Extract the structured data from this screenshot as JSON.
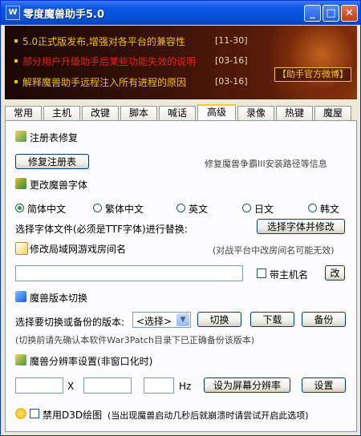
{
  "window": {
    "title": "零度魔兽助手5.0"
  },
  "banner": {
    "news": [
      {
        "text": "5.0正式版发布,增强对各平台的兼容性",
        "date": "[11-30]",
        "color": "#f0c000"
      },
      {
        "text": "部分用户升级助手后某些功能失效的说明",
        "date": "[03-16]",
        "color": "#e0251d"
      },
      {
        "text": "解释魔兽助手远程注入所有进程的原因",
        "date": "[03-16]",
        "color": "#f0c000"
      }
    ],
    "weibo": "【助手官方微博】"
  },
  "tabs": [
    "常用",
    "主机",
    "改键",
    "脚本",
    "喊话",
    "高级",
    "录像",
    "热键",
    "魔屋"
  ],
  "active_tab": "高级",
  "registry": {
    "title": "注册表修复",
    "button": "修复注册表",
    "hint": "修复魔兽争霸III安装路径等信息"
  },
  "font": {
    "title": "更改魔兽字体",
    "options": [
      "简体中文",
      "繁体中文",
      "英文",
      "日文",
      "韩文"
    ],
    "selected": "简体中文",
    "file_label": "选择字体文件(必须是TTF字体)进行替换:",
    "button": "选择字体并修改"
  },
  "room": {
    "title": "修改局域网游戏房间名",
    "hint": "(对战平台中改房间名可能无效)",
    "host_label": "带主机名",
    "change_btn": "改"
  },
  "version": {
    "title": "魔兽版本切换",
    "label": "选择要切换或备份的版本:",
    "select_value": "<选择>",
    "switch_btn": "切换",
    "download_btn": "下载",
    "backup_btn": "备份",
    "hint": "(切换前请先确认本软件War3Patch目录下已正确备份该版本)"
  },
  "resolution": {
    "title": "魔兽分辨率设置(非窗口化时)",
    "x": "X",
    "hz": "Hz",
    "set_screen_btn": "设为屏幕分辨率",
    "set_btn": "设置"
  },
  "d3d": {
    "label": "禁用D3D绘图",
    "hint": "(当出现魔兽启动几秒后就崩溃时请尝试开启此选项)"
  }
}
